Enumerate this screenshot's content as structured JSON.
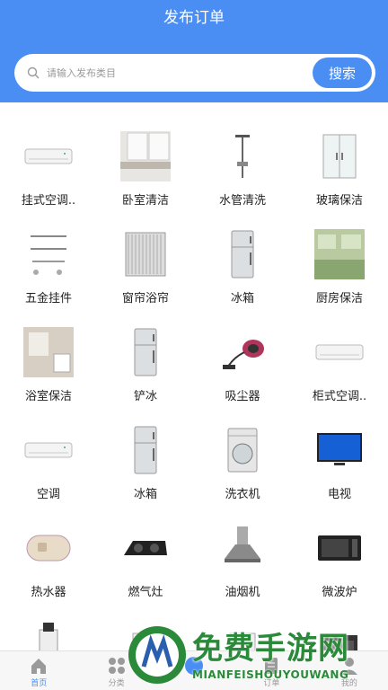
{
  "header": {
    "title": "发布订单"
  },
  "search": {
    "placeholder": "请输入发布类目",
    "button_label": "搜索"
  },
  "categories": [
    {
      "label": "挂式空调..",
      "icon": "wall-ac-icon"
    },
    {
      "label": "卧室清洁",
      "icon": "bedroom-icon"
    },
    {
      "label": "水管清洗",
      "icon": "shower-pipe-icon"
    },
    {
      "label": "玻璃保洁",
      "icon": "glass-door-icon"
    },
    {
      "label": "五金挂件",
      "icon": "towel-rack-icon"
    },
    {
      "label": "窗帘浴帘",
      "icon": "curtain-icon"
    },
    {
      "label": "冰箱",
      "icon": "fridge-icon"
    },
    {
      "label": "厨房保洁",
      "icon": "kitchen-icon"
    },
    {
      "label": "浴室保洁",
      "icon": "bathroom-icon"
    },
    {
      "label": "铲冰",
      "icon": "fridge-icon"
    },
    {
      "label": "吸尘器",
      "icon": "vacuum-icon"
    },
    {
      "label": "柜式空调..",
      "icon": "ac-unit-icon"
    },
    {
      "label": "空调",
      "icon": "wall-ac-icon"
    },
    {
      "label": "冰箱",
      "icon": "fridge-icon"
    },
    {
      "label": "洗衣机",
      "icon": "washing-machine-icon"
    },
    {
      "label": "电视",
      "icon": "tv-icon"
    },
    {
      "label": "热水器",
      "icon": "water-heater-icon"
    },
    {
      "label": "燃气灶",
      "icon": "gas-stove-icon"
    },
    {
      "label": "油烟机",
      "icon": "range-hood-icon"
    },
    {
      "label": "微波炉",
      "icon": "microwave-icon"
    },
    {
      "label": "",
      "icon": "water-dispenser-icon"
    },
    {
      "label": "",
      "icon": "appliance-icon"
    },
    {
      "label": "",
      "icon": "appliance-icon"
    },
    {
      "label": "",
      "icon": "oven-icon"
    }
  ],
  "nav": [
    {
      "label": "首页",
      "icon": "home-icon"
    },
    {
      "label": "分类",
      "icon": "grid-icon"
    },
    {
      "label": "",
      "icon": "publish-icon"
    },
    {
      "label": "订单",
      "icon": "order-icon"
    },
    {
      "label": "我的",
      "icon": "user-icon"
    }
  ],
  "watermark": {
    "title": "免费手游网",
    "subtitle": "MIANFEISHOUYOUWANG"
  },
  "colors": {
    "primary": "#4a8ef4",
    "watermark": "#2a8a3a"
  }
}
